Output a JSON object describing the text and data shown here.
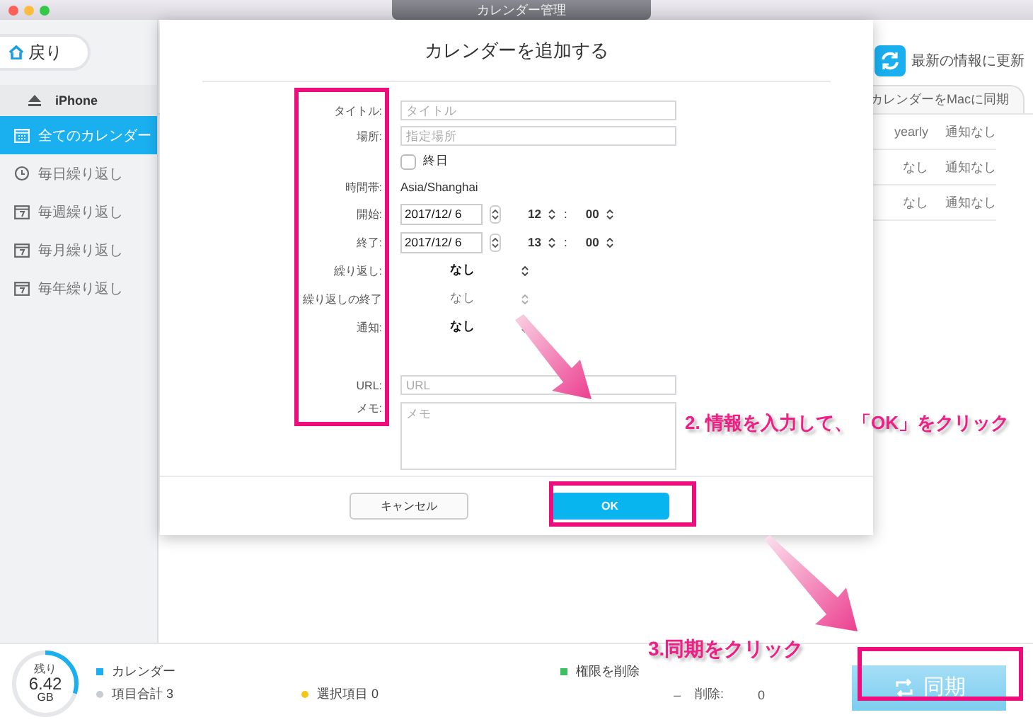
{
  "window": {
    "title": "カレンダー管理"
  },
  "toolbar": {
    "back_label": "戻り",
    "refresh_label": "最新の情報に更新"
  },
  "sidebar": {
    "device": "iPhone",
    "items": [
      {
        "label": "全てのカレンダー",
        "kind": "all",
        "selected": true
      },
      {
        "label": "毎日繰り返し",
        "kind": "daily",
        "selected": false
      },
      {
        "label": "毎週繰り返し",
        "kind": "weekly",
        "selected": false
      },
      {
        "label": "毎月繰り返し",
        "kind": "monthly",
        "selected": false
      },
      {
        "label": "毎年繰り返し",
        "kind": "yearly",
        "selected": false
      }
    ]
  },
  "tab": {
    "label": "カレンダーをMacに同期"
  },
  "table": {
    "rows": [
      {
        "repeat": "yearly",
        "alert": "通知なし"
      },
      {
        "repeat": "なし",
        "alert": "通知なし"
      },
      {
        "repeat": "なし",
        "alert": "通知なし"
      }
    ]
  },
  "dialog": {
    "title": "カレンダーを追加する",
    "fields": [
      {
        "kind": "text",
        "label": "タイトル:",
        "placeholder": "タイトル"
      },
      {
        "kind": "text",
        "label": "場所:",
        "placeholder": "指定場所"
      },
      {
        "kind": "checkbox",
        "label": "終日",
        "checked": false
      },
      {
        "kind": "info",
        "label": "時間帯:",
        "value": "Asia/Shanghai"
      },
      {
        "kind": "datetime",
        "label": "開始:",
        "date": "2017/12/ 6",
        "hour": "12",
        "separator": ":",
        "minute": "00"
      },
      {
        "kind": "datetime",
        "label": "終了:",
        "date": "2017/12/ 6",
        "hour": "13",
        "separator": ":",
        "minute": "00"
      },
      {
        "kind": "select",
        "label": "繰り返し:",
        "value": "なし",
        "disabled": false
      },
      {
        "kind": "select",
        "label": "繰り返しの終了",
        "value": "なし",
        "disabled": true
      },
      {
        "kind": "select",
        "label": "通知:",
        "value": "なし",
        "disabled": false
      },
      {
        "kind": "text",
        "label": "URL:",
        "placeholder": "URL"
      },
      {
        "kind": "textarea",
        "label": "メモ:",
        "placeholder": "メモ"
      }
    ],
    "buttons": [
      {
        "label": "キャンセル",
        "primary": false
      },
      {
        "label": "OK",
        "primary": true
      }
    ]
  },
  "status_bar": {
    "storage": {
      "caption": "残り",
      "value": "6.42",
      "unit": "GB",
      "level": 0.3
    },
    "legend": [
      {
        "label": "カレンダー",
        "color": "#1ab0f0"
      },
      {
        "label": "項目合計 3",
        "color": "#c8ccd4"
      },
      {
        "label": "選択項目 0",
        "color": "#f5c518"
      },
      {
        "label": "権限を削除",
        "color": "#3cc060"
      }
    ],
    "delete": {
      "mark": "–",
      "label": "削除:",
      "value": "0"
    },
    "sync_label": "同期"
  },
  "annotations": [
    {
      "text": "2. 情報を入力して、「OK」をクリック"
    },
    {
      "text": "3.同期をクリック"
    }
  ]
}
